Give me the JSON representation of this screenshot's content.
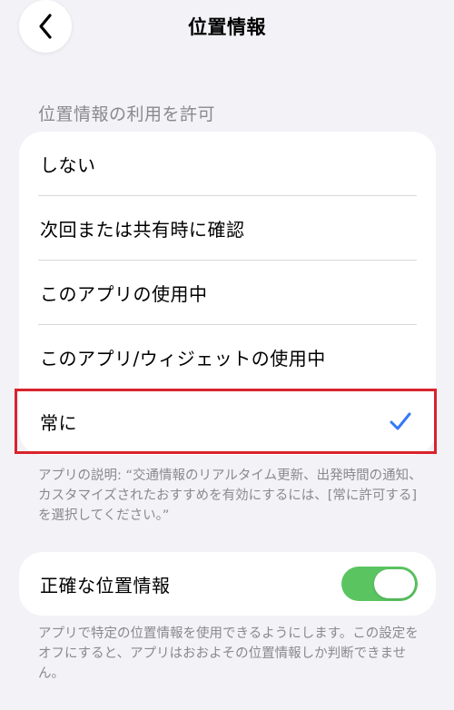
{
  "header": {
    "title": "位置情報",
    "back_icon": "chevron-left-icon"
  },
  "allow_section": {
    "title": "位置情報の利用を許可",
    "options": [
      {
        "label": "しない",
        "selected": false
      },
      {
        "label": "次回または共有時に確認",
        "selected": false
      },
      {
        "label": "このアプリの使用中",
        "selected": false
      },
      {
        "label": "このアプリ/ウィジェットの使用中",
        "selected": false
      },
      {
        "label": "常に",
        "selected": true
      }
    ],
    "description": "アプリの説明: “交通情報のリアルタイム更新、出発時間の通知、カスタマイズされたおすすめを有効にするには、[常に許可する] を選択してください。”"
  },
  "precise_location": {
    "label": "正確な位置情報",
    "enabled": true,
    "description": "アプリで特定の位置情報を使用できるようにします。この設定をオフにすると、アプリはおおよその位置情報しか判断できません。"
  },
  "colors": {
    "background": "#f2f2f7",
    "card": "#ffffff",
    "accent_blue": "#3478f6",
    "toggle_green": "#5ac461",
    "secondary_text": "#8a8a8e",
    "highlight_red": "#d9232d"
  }
}
